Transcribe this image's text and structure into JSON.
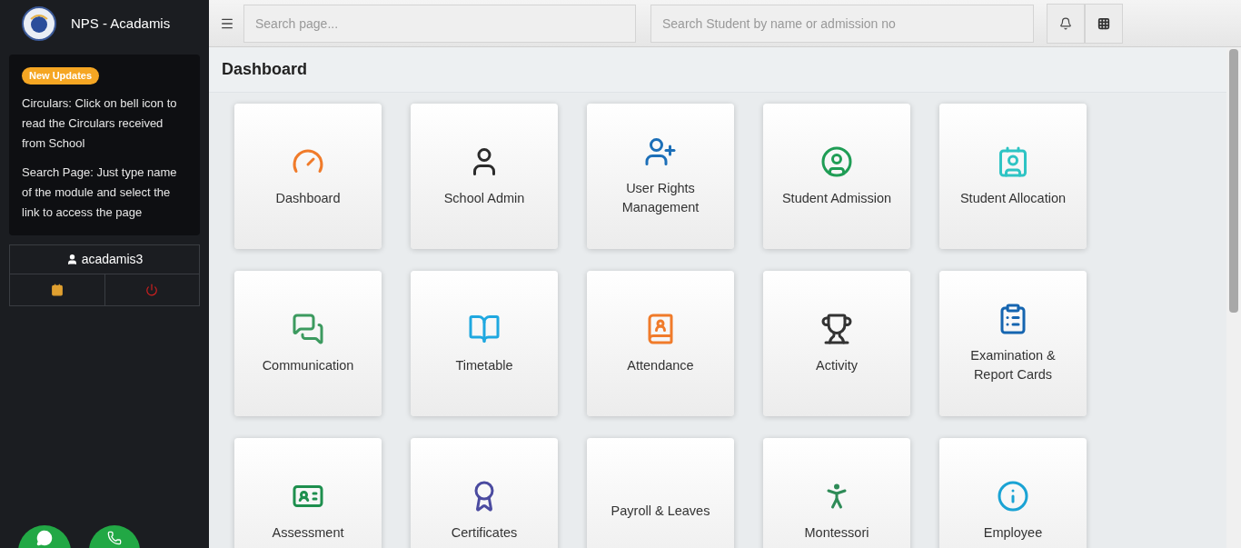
{
  "brand": {
    "title": "NPS - Acadamis"
  },
  "updates": {
    "badge": "New Updates",
    "notes": [
      "Circulars: Click on bell icon to read the Circulars received from School",
      "Search Page: Just type name of the module and select the link to access the page"
    ]
  },
  "user": {
    "name": "acadamis3"
  },
  "topbar": {
    "page_search": {
      "placeholder": "Search page..."
    },
    "student_search": {
      "placeholder": "Search Student by name or admission no"
    }
  },
  "page_title": "Dashboard",
  "modules": [
    {
      "label": "Dashboard"
    },
    {
      "label": "School Admin"
    },
    {
      "label": "User Rights Management"
    },
    {
      "label": "Student Admission"
    },
    {
      "label": "Student Allocation"
    },
    {
      "label": "Communication"
    },
    {
      "label": "Timetable"
    },
    {
      "label": "Attendance"
    },
    {
      "label": "Activity"
    },
    {
      "label": "Examination & Report Cards"
    },
    {
      "label": "Assessment"
    },
    {
      "label": "Certificates"
    },
    {
      "label": "Payroll & Leaves"
    },
    {
      "label": "Montessori"
    },
    {
      "label": "Employee"
    }
  ]
}
